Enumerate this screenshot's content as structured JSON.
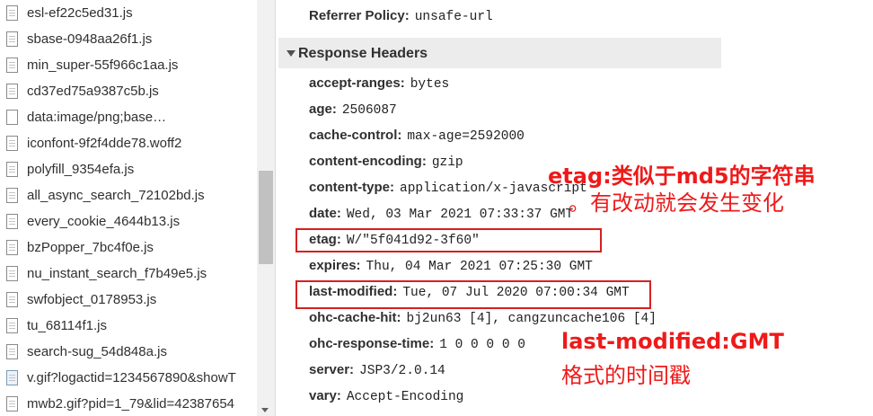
{
  "files": [
    {
      "name": "esl-ef22c5ed31.js",
      "icon": "file-icon"
    },
    {
      "name": "sbase-0948aa26f1.js",
      "icon": "file-icon"
    },
    {
      "name": "min_super-55f966c1aa.js",
      "icon": "file-icon"
    },
    {
      "name": "cd37ed75a9387c5b.js",
      "icon": "file-icon"
    },
    {
      "name": "data:image/png;base…",
      "icon": "blank-file-icon"
    },
    {
      "name": "iconfont-9f2f4dde78.woff2",
      "icon": "file-icon"
    },
    {
      "name": "polyfill_9354efa.js",
      "icon": "file-icon"
    },
    {
      "name": "all_async_search_72102bd.js",
      "icon": "file-icon"
    },
    {
      "name": "every_cookie_4644b13.js",
      "icon": "file-icon"
    },
    {
      "name": "bzPopper_7bc4f0e.js",
      "icon": "file-icon"
    },
    {
      "name": "nu_instant_search_f7b49e5.js",
      "icon": "file-icon"
    },
    {
      "name": "swfobject_0178953.js",
      "icon": "file-icon"
    },
    {
      "name": "tu_68114f1.js",
      "icon": "file-icon"
    },
    {
      "name": "search-sug_54d848a.js",
      "icon": "file-icon"
    },
    {
      "name": "v.gif?logactid=1234567890&showT",
      "icon": "image-file-icon"
    },
    {
      "name": "mwb2.gif?pid=1_79&lid=42387654",
      "icon": "file-icon"
    }
  ],
  "referrer_policy": {
    "key": "Referrer Policy:",
    "value": "unsafe-url"
  },
  "response_headers_title": "Response Headers",
  "headers": [
    {
      "key": "accept-ranges:",
      "value": "bytes"
    },
    {
      "key": "age:",
      "value": "2506087"
    },
    {
      "key": "cache-control:",
      "value": "max-age=2592000"
    },
    {
      "key": "content-encoding:",
      "value": "gzip"
    },
    {
      "key": "content-type:",
      "value": "application/x-javascript"
    },
    {
      "key": "date:",
      "value": "Wed, 03 Mar 2021 07:33:37 GMT"
    },
    {
      "key": "etag:",
      "value": "W/\"5f041d92-3f60\""
    },
    {
      "key": "expires:",
      "value": "Thu, 04 Mar 2021 07:25:30 GMT"
    },
    {
      "key": "last-modified:",
      "value": "Tue, 07 Jul 2020 07:00:34 GMT"
    },
    {
      "key": "ohc-cache-hit:",
      "value": "bj2un63 [4], cangzuncache106 [4]"
    },
    {
      "key": "ohc-response-time:",
      "value": "1 0 0 0 0 0"
    },
    {
      "key": "server:",
      "value": "JSP3/2.0.14"
    },
    {
      "key": "vary:",
      "value": "Accept-Encoding"
    }
  ],
  "annotations": {
    "etag_line1": "etag:类似于md5的字符串",
    "etag_line2": "。有改动就会发生变化",
    "lastmod_line1": "last-modified:GMT",
    "lastmod_line2": "格式的时间戳"
  },
  "colors": {
    "annotation": "#ee1a1a",
    "box": "#d62020"
  }
}
